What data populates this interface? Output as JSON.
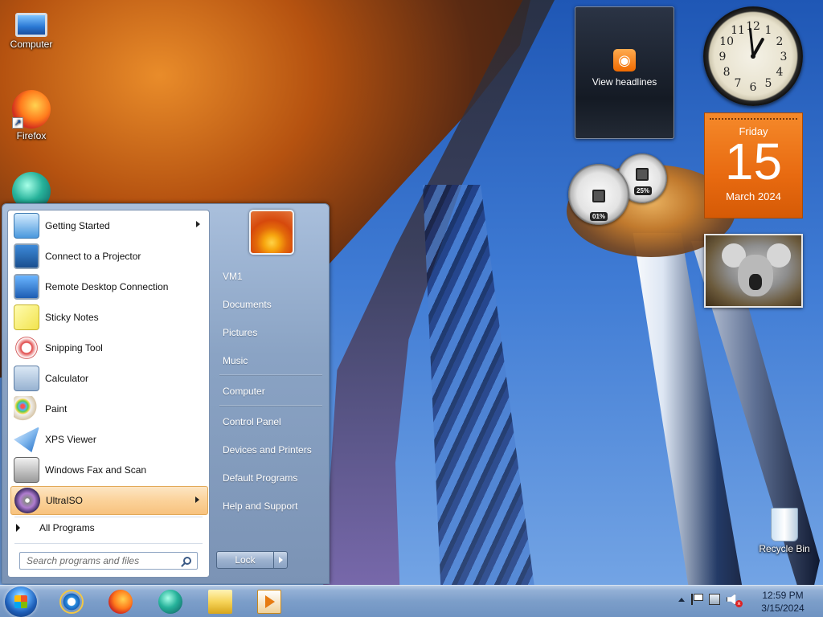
{
  "desktop": {
    "icons": [
      {
        "label": "Computer",
        "icon": "computer-icon"
      },
      {
        "label": "Firefox",
        "icon": "firefox-icon"
      },
      {
        "label": "Recycle Bin",
        "icon": "recycle-bin-icon"
      }
    ]
  },
  "gadgets": {
    "feed": {
      "label": "View headlines",
      "icon": "rss-icon"
    },
    "clock": {
      "hour": 12,
      "minute": 59,
      "numerals": [
        "12",
        "1",
        "2",
        "3",
        "4",
        "5",
        "6",
        "7",
        "8",
        "9",
        "10",
        "11"
      ]
    },
    "calendar": {
      "weekday": "Friday",
      "day": "15",
      "month_year": "March 2024"
    },
    "cpu_meter": {
      "cpu": "01%",
      "memory": "25%",
      "cpu_level": 0.01,
      "memory_level": 0.25
    },
    "slideshow": {
      "subject": "koala"
    }
  },
  "start_menu": {
    "programs": [
      {
        "label": "Getting Started",
        "icon": "getting-started-icon",
        "has_submenu": true
      },
      {
        "label": "Connect to a Projector",
        "icon": "projector-icon",
        "has_submenu": false
      },
      {
        "label": "Remote Desktop Connection",
        "icon": "remote-desktop-icon",
        "has_submenu": false
      },
      {
        "label": "Sticky Notes",
        "icon": "sticky-notes-icon",
        "has_submenu": false
      },
      {
        "label": "Snipping Tool",
        "icon": "snipping-tool-icon",
        "has_submenu": false
      },
      {
        "label": "Calculator",
        "icon": "calculator-icon",
        "has_submenu": false
      },
      {
        "label": "Paint",
        "icon": "paint-icon",
        "has_submenu": false
      },
      {
        "label": "XPS Viewer",
        "icon": "xps-viewer-icon",
        "has_submenu": false
      },
      {
        "label": "Windows Fax and Scan",
        "icon": "fax-scan-icon",
        "has_submenu": false
      },
      {
        "label": "UltraISO",
        "icon": "ultraiso-icon",
        "has_submenu": true,
        "highlighted": true
      }
    ],
    "all_programs": "All Programs",
    "search": {
      "placeholder": "Search programs and files",
      "value": ""
    },
    "right_links": [
      {
        "label": "VM1"
      },
      {
        "label": "Documents"
      },
      {
        "label": "Pictures"
      },
      {
        "label": "Music"
      },
      {
        "label": "Computer"
      },
      {
        "label": "Control Panel"
      },
      {
        "label": "Devices and Printers"
      },
      {
        "label": "Default Programs"
      },
      {
        "label": "Help and Support"
      }
    ],
    "power": {
      "label": "Lock"
    }
  },
  "taskbar": {
    "start_icon": "windows-logo-icon",
    "pinned": [
      {
        "name": "internet-explorer-icon"
      },
      {
        "name": "firefox-icon"
      },
      {
        "name": "app-orb-icon"
      },
      {
        "name": "windows-explorer-icon"
      },
      {
        "name": "media-player-icon"
      }
    ],
    "tray": {
      "time": "12:59 PM",
      "date": "3/15/2024",
      "volume_muted": true
    }
  }
}
